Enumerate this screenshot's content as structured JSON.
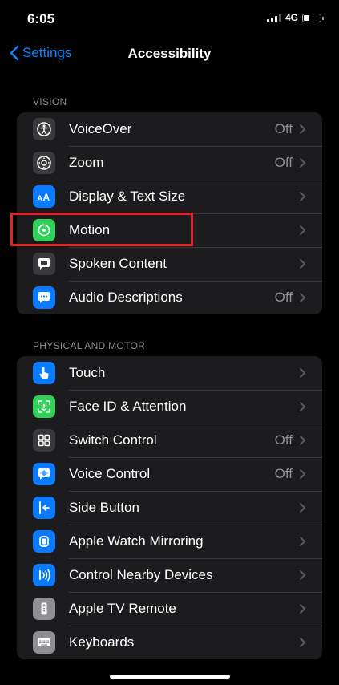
{
  "status": {
    "time": "6:05",
    "network": "4G"
  },
  "nav": {
    "back_label": "Settings",
    "title": "Accessibility"
  },
  "vision": {
    "header": "VISION",
    "items": [
      {
        "label": "VoiceOver",
        "value": "Off",
        "icon": "voiceover-icon",
        "color": "#3a3a3c"
      },
      {
        "label": "Zoom",
        "value": "Off",
        "icon": "zoom-icon",
        "color": "#3a3a3c"
      },
      {
        "label": "Display & Text Size",
        "value": "",
        "icon": "text-size-icon",
        "color": "#0a7aff"
      },
      {
        "label": "Motion",
        "value": "",
        "icon": "motion-icon",
        "color": "#30d158"
      },
      {
        "label": "Spoken Content",
        "value": "",
        "icon": "speech-bubble-icon",
        "color": "#3a3a3c"
      },
      {
        "label": "Audio Descriptions",
        "value": "Off",
        "icon": "audio-description-icon",
        "color": "#0a7aff"
      }
    ]
  },
  "physical": {
    "header": "PHYSICAL AND MOTOR",
    "items": [
      {
        "label": "Touch",
        "value": "",
        "icon": "hand-pointer-icon",
        "color": "#0a7aff"
      },
      {
        "label": "Face ID & Attention",
        "value": "",
        "icon": "face-id-icon",
        "color": "#30d158"
      },
      {
        "label": "Switch Control",
        "value": "Off",
        "icon": "grid-icon",
        "color": "#3a3a3c"
      },
      {
        "label": "Voice Control",
        "value": "Off",
        "icon": "voice-control-icon",
        "color": "#0a7aff"
      },
      {
        "label": "Side Button",
        "value": "",
        "icon": "side-button-icon",
        "color": "#0a7aff"
      },
      {
        "label": "Apple Watch Mirroring",
        "value": "",
        "icon": "watch-icon",
        "color": "#0a7aff"
      },
      {
        "label": "Control Nearby Devices",
        "value": "",
        "icon": "nearby-devices-icon",
        "color": "#0a7aff"
      },
      {
        "label": "Apple TV Remote",
        "value": "",
        "icon": "remote-icon",
        "color": "#8e8e93"
      },
      {
        "label": "Keyboards",
        "value": "",
        "icon": "keyboard-icon",
        "color": "#8e8e93"
      }
    ]
  },
  "accent_color": "#0a84ff",
  "highlight_color": "#e0232b"
}
